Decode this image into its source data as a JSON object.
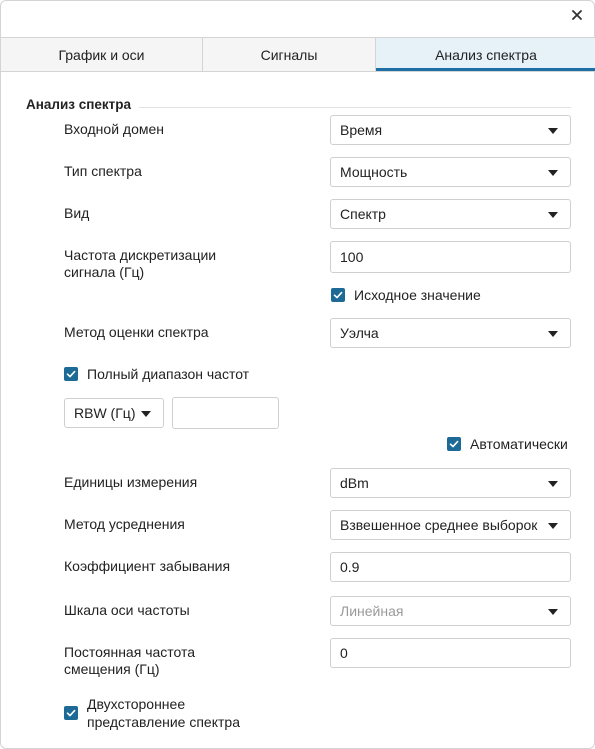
{
  "close_icon": "close-icon",
  "tabs": [
    {
      "label": "График и оси"
    },
    {
      "label": "Сигналы"
    },
    {
      "label": "Анализ спектра"
    }
  ],
  "section": {
    "title": "Анализ спектра"
  },
  "fields": {
    "input_domain": {
      "label": "Входной домен",
      "value": "Время"
    },
    "spectrum_type": {
      "label": "Тип спектра",
      "value": "Мощность"
    },
    "view": {
      "label": "Вид",
      "value": "Спектр"
    },
    "sample_rate": {
      "label_line1": "Частота дискретизации",
      "label_line2": "сигнала (Гц)",
      "value": "100"
    },
    "inherit_sample_rate": {
      "label": "Исходное значение",
      "checked": true
    },
    "estimation_method": {
      "label": "Метод оценки спектра",
      "value": "Уэлча"
    },
    "full_frequency_range": {
      "label": "Полный диапазон частот",
      "checked": true
    },
    "rbw": {
      "select_value": "RBW (Гц)",
      "input_value": ""
    },
    "auto": {
      "label": "Автоматически",
      "checked": true
    },
    "units": {
      "label": "Единицы измерения",
      "value": "dBm"
    },
    "averaging_method": {
      "label": "Метод усреднения",
      "value": "Взвешенное среднее выборок"
    },
    "forgetting_factor": {
      "label": "Коэффициент забывания",
      "value": "0.9"
    },
    "frequency_scale": {
      "label": "Шкала оси частоты",
      "value": "Линейная"
    },
    "frequency_offset": {
      "label_line1": "Постоянная частота",
      "label_line2": "смещения (Гц)",
      "value": "0"
    },
    "two_sided": {
      "label_line1": "Двухстороннее",
      "label_line2": "представление спектра",
      "checked": true
    }
  },
  "colors": {
    "accent": "#1d6fa5",
    "checkbox": "#1d6a96",
    "active_tab_bg": "#e6f1f8"
  }
}
